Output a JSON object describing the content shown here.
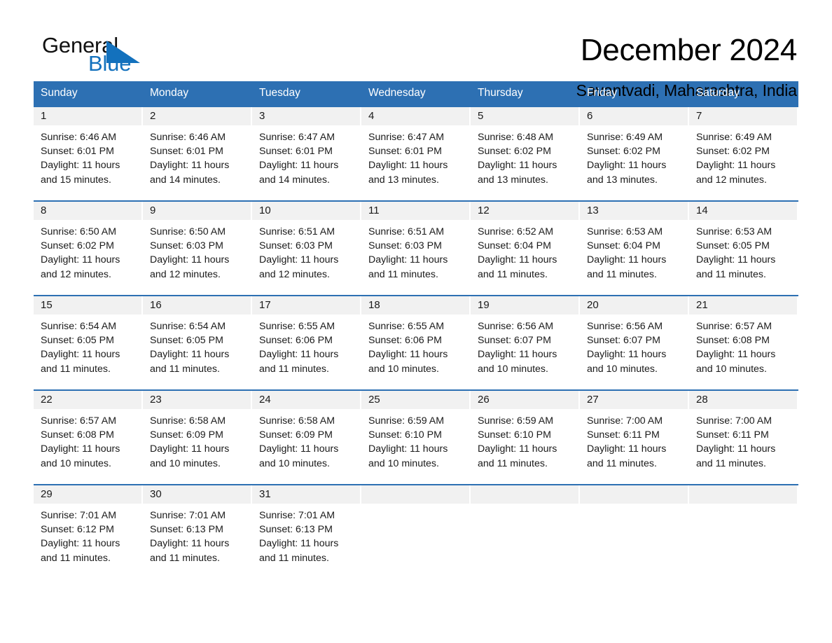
{
  "brand": {
    "name_part1": "General",
    "name_part2": "Blue",
    "triangle_color": "#1371bd",
    "text_color": "#111111"
  },
  "header": {
    "title": "December 2024",
    "location": "Savantvadi, Maharashtra, India"
  },
  "theme": {
    "header_blue": "#2d70b3",
    "row_rule_blue": "#2d70b3",
    "daynum_band": "#f1f1f1",
    "page_background": "#ffffff",
    "text": "#1a1a1a"
  },
  "weekday_headers": [
    "Sunday",
    "Monday",
    "Tuesday",
    "Wednesday",
    "Thursday",
    "Friday",
    "Saturday"
  ],
  "labels": {
    "sunrise_prefix": "Sunrise:",
    "sunset_prefix": "Sunset:",
    "daylight_prefix": "Daylight:"
  },
  "weeks": [
    [
      {
        "day": "1",
        "sunrise": "Sunrise: 6:46 AM",
        "sunset": "Sunset: 6:01 PM",
        "daylight_line1": "Daylight: 11 hours",
        "daylight_line2": "and 15 minutes."
      },
      {
        "day": "2",
        "sunrise": "Sunrise: 6:46 AM",
        "sunset": "Sunset: 6:01 PM",
        "daylight_line1": "Daylight: 11 hours",
        "daylight_line2": "and 14 minutes."
      },
      {
        "day": "3",
        "sunrise": "Sunrise: 6:47 AM",
        "sunset": "Sunset: 6:01 PM",
        "daylight_line1": "Daylight: 11 hours",
        "daylight_line2": "and 14 minutes."
      },
      {
        "day": "4",
        "sunrise": "Sunrise: 6:47 AM",
        "sunset": "Sunset: 6:01 PM",
        "daylight_line1": "Daylight: 11 hours",
        "daylight_line2": "and 13 minutes."
      },
      {
        "day": "5",
        "sunrise": "Sunrise: 6:48 AM",
        "sunset": "Sunset: 6:02 PM",
        "daylight_line1": "Daylight: 11 hours",
        "daylight_line2": "and 13 minutes."
      },
      {
        "day": "6",
        "sunrise": "Sunrise: 6:49 AM",
        "sunset": "Sunset: 6:02 PM",
        "daylight_line1": "Daylight: 11 hours",
        "daylight_line2": "and 13 minutes."
      },
      {
        "day": "7",
        "sunrise": "Sunrise: 6:49 AM",
        "sunset": "Sunset: 6:02 PM",
        "daylight_line1": "Daylight: 11 hours",
        "daylight_line2": "and 12 minutes."
      }
    ],
    [
      {
        "day": "8",
        "sunrise": "Sunrise: 6:50 AM",
        "sunset": "Sunset: 6:02 PM",
        "daylight_line1": "Daylight: 11 hours",
        "daylight_line2": "and 12 minutes."
      },
      {
        "day": "9",
        "sunrise": "Sunrise: 6:50 AM",
        "sunset": "Sunset: 6:03 PM",
        "daylight_line1": "Daylight: 11 hours",
        "daylight_line2": "and 12 minutes."
      },
      {
        "day": "10",
        "sunrise": "Sunrise: 6:51 AM",
        "sunset": "Sunset: 6:03 PM",
        "daylight_line1": "Daylight: 11 hours",
        "daylight_line2": "and 12 minutes."
      },
      {
        "day": "11",
        "sunrise": "Sunrise: 6:51 AM",
        "sunset": "Sunset: 6:03 PM",
        "daylight_line1": "Daylight: 11 hours",
        "daylight_line2": "and 11 minutes."
      },
      {
        "day": "12",
        "sunrise": "Sunrise: 6:52 AM",
        "sunset": "Sunset: 6:04 PM",
        "daylight_line1": "Daylight: 11 hours",
        "daylight_line2": "and 11 minutes."
      },
      {
        "day": "13",
        "sunrise": "Sunrise: 6:53 AM",
        "sunset": "Sunset: 6:04 PM",
        "daylight_line1": "Daylight: 11 hours",
        "daylight_line2": "and 11 minutes."
      },
      {
        "day": "14",
        "sunrise": "Sunrise: 6:53 AM",
        "sunset": "Sunset: 6:05 PM",
        "daylight_line1": "Daylight: 11 hours",
        "daylight_line2": "and 11 minutes."
      }
    ],
    [
      {
        "day": "15",
        "sunrise": "Sunrise: 6:54 AM",
        "sunset": "Sunset: 6:05 PM",
        "daylight_line1": "Daylight: 11 hours",
        "daylight_line2": "and 11 minutes."
      },
      {
        "day": "16",
        "sunrise": "Sunrise: 6:54 AM",
        "sunset": "Sunset: 6:05 PM",
        "daylight_line1": "Daylight: 11 hours",
        "daylight_line2": "and 11 minutes."
      },
      {
        "day": "17",
        "sunrise": "Sunrise: 6:55 AM",
        "sunset": "Sunset: 6:06 PM",
        "daylight_line1": "Daylight: 11 hours",
        "daylight_line2": "and 11 minutes."
      },
      {
        "day": "18",
        "sunrise": "Sunrise: 6:55 AM",
        "sunset": "Sunset: 6:06 PM",
        "daylight_line1": "Daylight: 11 hours",
        "daylight_line2": "and 10 minutes."
      },
      {
        "day": "19",
        "sunrise": "Sunrise: 6:56 AM",
        "sunset": "Sunset: 6:07 PM",
        "daylight_line1": "Daylight: 11 hours",
        "daylight_line2": "and 10 minutes."
      },
      {
        "day": "20",
        "sunrise": "Sunrise: 6:56 AM",
        "sunset": "Sunset: 6:07 PM",
        "daylight_line1": "Daylight: 11 hours",
        "daylight_line2": "and 10 minutes."
      },
      {
        "day": "21",
        "sunrise": "Sunrise: 6:57 AM",
        "sunset": "Sunset: 6:08 PM",
        "daylight_line1": "Daylight: 11 hours",
        "daylight_line2": "and 10 minutes."
      }
    ],
    [
      {
        "day": "22",
        "sunrise": "Sunrise: 6:57 AM",
        "sunset": "Sunset: 6:08 PM",
        "daylight_line1": "Daylight: 11 hours",
        "daylight_line2": "and 10 minutes."
      },
      {
        "day": "23",
        "sunrise": "Sunrise: 6:58 AM",
        "sunset": "Sunset: 6:09 PM",
        "daylight_line1": "Daylight: 11 hours",
        "daylight_line2": "and 10 minutes."
      },
      {
        "day": "24",
        "sunrise": "Sunrise: 6:58 AM",
        "sunset": "Sunset: 6:09 PM",
        "daylight_line1": "Daylight: 11 hours",
        "daylight_line2": "and 10 minutes."
      },
      {
        "day": "25",
        "sunrise": "Sunrise: 6:59 AM",
        "sunset": "Sunset: 6:10 PM",
        "daylight_line1": "Daylight: 11 hours",
        "daylight_line2": "and 10 minutes."
      },
      {
        "day": "26",
        "sunrise": "Sunrise: 6:59 AM",
        "sunset": "Sunset: 6:10 PM",
        "daylight_line1": "Daylight: 11 hours",
        "daylight_line2": "and 11 minutes."
      },
      {
        "day": "27",
        "sunrise": "Sunrise: 7:00 AM",
        "sunset": "Sunset: 6:11 PM",
        "daylight_line1": "Daylight: 11 hours",
        "daylight_line2": "and 11 minutes."
      },
      {
        "day": "28",
        "sunrise": "Sunrise: 7:00 AM",
        "sunset": "Sunset: 6:11 PM",
        "daylight_line1": "Daylight: 11 hours",
        "daylight_line2": "and 11 minutes."
      }
    ],
    [
      {
        "day": "29",
        "sunrise": "Sunrise: 7:01 AM",
        "sunset": "Sunset: 6:12 PM",
        "daylight_line1": "Daylight: 11 hours",
        "daylight_line2": "and 11 minutes."
      },
      {
        "day": "30",
        "sunrise": "Sunrise: 7:01 AM",
        "sunset": "Sunset: 6:13 PM",
        "daylight_line1": "Daylight: 11 hours",
        "daylight_line2": "and 11 minutes."
      },
      {
        "day": "31",
        "sunrise": "Sunrise: 7:01 AM",
        "sunset": "Sunset: 6:13 PM",
        "daylight_line1": "Daylight: 11 hours",
        "daylight_line2": "and 11 minutes."
      },
      {
        "day": "",
        "sunrise": "",
        "sunset": "",
        "daylight_line1": "",
        "daylight_line2": ""
      },
      {
        "day": "",
        "sunrise": "",
        "sunset": "",
        "daylight_line1": "",
        "daylight_line2": ""
      },
      {
        "day": "",
        "sunrise": "",
        "sunset": "",
        "daylight_line1": "",
        "daylight_line2": ""
      },
      {
        "day": "",
        "sunrise": "",
        "sunset": "",
        "daylight_line1": "",
        "daylight_line2": ""
      }
    ]
  ]
}
